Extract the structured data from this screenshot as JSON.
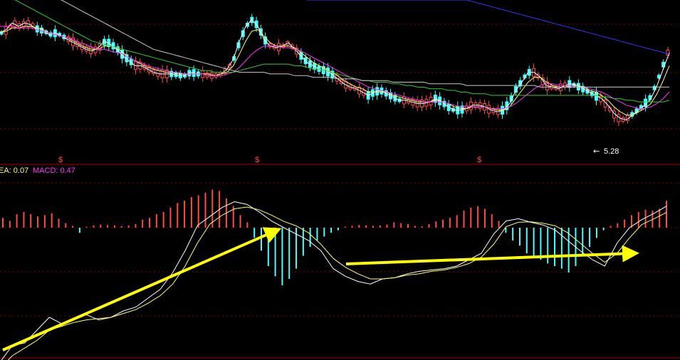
{
  "chart_data": [
    {
      "type": "candlestick",
      "panel": "price",
      "colors": {
        "up": "#ff4a4a",
        "down": "#44ffff",
        "background": "#000000",
        "grid": "#8b0000"
      },
      "low_marker": {
        "label": "5.28",
        "arrow": "←"
      },
      "event_marks": [
        "$",
        "$",
        "$"
      ],
      "series": [
        {
          "color": "#ffffff",
          "values": [
            0.8,
            0.82,
            0.86,
            0.84,
            0.86,
            0.85,
            0.82,
            0.81,
            0.79,
            0.8,
            0.78,
            0.76,
            0.74,
            0.72,
            0.7,
            0.69,
            0.71,
            0.75,
            0.73,
            0.7,
            0.66,
            0.63,
            0.6,
            0.6,
            0.58,
            0.56,
            0.55,
            0.55,
            0.55,
            0.54,
            0.54,
            0.56,
            0.55,
            0.55,
            0.54,
            0.54,
            0.55,
            0.58,
            0.64,
            0.75,
            0.84,
            0.88,
            0.84,
            0.76,
            0.72,
            0.71,
            0.72,
            0.74,
            0.7,
            0.66,
            0.62,
            0.6,
            0.58,
            0.57,
            0.55,
            0.52,
            0.49,
            0.47,
            0.46,
            0.44,
            0.42,
            0.44,
            0.45,
            0.43,
            0.41,
            0.39,
            0.39,
            0.38,
            0.37,
            0.37,
            0.38,
            0.4,
            0.38,
            0.35,
            0.33,
            0.33,
            0.34,
            0.36,
            0.36,
            0.35,
            0.33,
            0.32,
            0.33,
            0.37,
            0.45,
            0.5,
            0.56,
            0.56,
            0.53,
            0.48,
            0.47,
            0.46,
            0.48,
            0.49,
            0.48,
            0.46,
            0.44,
            0.42,
            0.4,
            0.36,
            0.31,
            0.28,
            0.27,
            0.3,
            0.33,
            0.36,
            0.4,
            0.48,
            0.58,
            0.68
          ]
        },
        {
          "color": "#ffff66",
          "values": [
            0.8,
            0.81,
            0.83,
            0.83,
            0.84,
            0.84,
            0.83,
            0.82,
            0.8,
            0.79,
            0.78,
            0.77,
            0.75,
            0.73,
            0.71,
            0.7,
            0.7,
            0.72,
            0.72,
            0.71,
            0.68,
            0.65,
            0.63,
            0.61,
            0.59,
            0.58,
            0.57,
            0.56,
            0.56,
            0.55,
            0.55,
            0.55,
            0.55,
            0.55,
            0.55,
            0.54,
            0.55,
            0.56,
            0.6,
            0.67,
            0.75,
            0.81,
            0.82,
            0.78,
            0.74,
            0.72,
            0.72,
            0.72,
            0.71,
            0.68,
            0.65,
            0.62,
            0.6,
            0.58,
            0.56,
            0.54,
            0.51,
            0.49,
            0.47,
            0.46,
            0.44,
            0.44,
            0.44,
            0.44,
            0.42,
            0.41,
            0.4,
            0.39,
            0.38,
            0.38,
            0.38,
            0.39,
            0.38,
            0.37,
            0.35,
            0.34,
            0.34,
            0.35,
            0.35,
            0.35,
            0.34,
            0.33,
            0.33,
            0.35,
            0.4,
            0.45,
            0.5,
            0.53,
            0.53,
            0.5,
            0.48,
            0.47,
            0.47,
            0.48,
            0.48,
            0.47,
            0.45,
            0.44,
            0.42,
            0.39,
            0.35,
            0.32,
            0.3,
            0.3,
            0.32,
            0.34,
            0.37,
            0.43,
            0.51,
            0.6
          ]
        },
        {
          "color": "#ff33ff",
          "values": [
            0.84,
            0.84,
            0.84,
            0.83,
            0.83,
            0.83,
            0.82,
            0.81,
            0.8,
            0.79,
            0.78,
            0.77,
            0.76,
            0.74,
            0.73,
            0.71,
            0.7,
            0.7,
            0.69,
            0.68,
            0.67,
            0.65,
            0.63,
            0.62,
            0.6,
            0.59,
            0.58,
            0.57,
            0.56,
            0.56,
            0.55,
            0.55,
            0.55,
            0.55,
            0.54,
            0.54,
            0.54,
            0.55,
            0.56,
            0.59,
            0.63,
            0.67,
            0.7,
            0.72,
            0.72,
            0.72,
            0.71,
            0.71,
            0.7,
            0.69,
            0.67,
            0.65,
            0.63,
            0.61,
            0.59,
            0.57,
            0.55,
            0.53,
            0.51,
            0.49,
            0.47,
            0.46,
            0.45,
            0.44,
            0.43,
            0.42,
            0.41,
            0.4,
            0.39,
            0.38,
            0.38,
            0.38,
            0.38,
            0.37,
            0.36,
            0.35,
            0.35,
            0.35,
            0.35,
            0.35,
            0.34,
            0.34,
            0.34,
            0.35,
            0.37,
            0.4,
            0.43,
            0.46,
            0.48,
            0.49,
            0.49,
            0.48,
            0.48,
            0.48,
            0.47,
            0.47,
            0.46,
            0.45,
            0.44,
            0.42,
            0.4,
            0.38,
            0.36,
            0.35,
            0.34,
            0.34,
            0.35,
            0.37,
            0.4,
            0.44
          ]
        },
        {
          "color": "#33cc33",
          "values": [
            1.05,
            1.03,
            1.01,
            0.99,
            0.97,
            0.95,
            0.93,
            0.91,
            0.89,
            0.87,
            0.85,
            0.83,
            0.81,
            0.79,
            0.77,
            0.75,
            0.74,
            0.73,
            0.72,
            0.71,
            0.7,
            0.69,
            0.68,
            0.67,
            0.66,
            0.65,
            0.64,
            0.63,
            0.62,
            0.61,
            0.6,
            0.59,
            0.58,
            0.57,
            0.57,
            0.56,
            0.56,
            0.56,
            0.56,
            0.57,
            0.58,
            0.59,
            0.6,
            0.61,
            0.61,
            0.61,
            0.61,
            0.61,
            0.6,
            0.6,
            0.59,
            0.58,
            0.58,
            0.57,
            0.56,
            0.55,
            0.54,
            0.53,
            0.52,
            0.51,
            0.51,
            0.5,
            0.5,
            0.5,
            0.49,
            0.49,
            0.48,
            0.48,
            0.47,
            0.47,
            0.46,
            0.46,
            0.46,
            0.45,
            0.45,
            0.44,
            0.44,
            0.43,
            0.43,
            0.43,
            0.42,
            0.42,
            0.42,
            0.42,
            0.42,
            0.42,
            0.42,
            0.42,
            0.42,
            0.42,
            0.42,
            0.42,
            0.42,
            0.42,
            0.42,
            0.42,
            0.42,
            0.42,
            0.41,
            0.41,
            0.4,
            0.4,
            0.39,
            0.39,
            0.38,
            0.38,
            0.38,
            0.38,
            0.38,
            0.39
          ]
        },
        {
          "color": "#c8c8c8",
          "values": [
            1.2,
            1.18,
            1.16,
            1.14,
            1.12,
            1.1,
            1.08,
            1.06,
            1.04,
            1.02,
            1.0,
            0.98,
            0.96,
            0.94,
            0.92,
            0.9,
            0.88,
            0.86,
            0.84,
            0.82,
            0.8,
            0.78,
            0.76,
            0.74,
            0.72,
            0.7,
            0.69,
            0.68,
            0.67,
            0.66,
            0.65,
            0.64,
            0.63,
            0.62,
            0.61,
            0.6,
            0.59,
            0.58,
            0.57,
            0.56,
            0.56,
            0.56,
            0.56,
            0.56,
            0.55,
            0.55,
            0.55,
            0.55,
            0.54,
            0.54,
            0.54,
            0.53,
            0.53,
            0.53,
            0.53,
            0.52,
            0.52,
            0.52,
            0.52,
            0.51,
            0.51,
            0.51,
            0.51,
            0.51,
            0.5,
            0.5,
            0.5,
            0.5,
            0.5,
            0.5,
            0.49,
            0.49,
            0.49,
            0.49,
            0.49,
            0.49,
            0.48,
            0.48,
            0.48,
            0.48,
            0.48,
            0.48,
            0.48,
            0.48,
            0.48,
            0.48,
            0.48,
            0.48,
            0.47,
            0.47,
            0.47,
            0.47,
            0.47,
            0.47,
            0.47,
            0.47,
            0.47,
            0.47,
            0.47,
            0.47,
            0.47,
            0.47,
            0.47,
            0.47,
            0.47,
            0.47,
            0.47,
            0.47,
            0.47,
            0.47
          ]
        },
        {
          "color": "#3333ff",
          "values": [
            1.5,
            1.49,
            1.48,
            1.47,
            1.46,
            1.45,
            1.44,
            1.43,
            1.42,
            1.41,
            1.4,
            1.39,
            1.38,
            1.37,
            1.36,
            1.35,
            1.34,
            1.33,
            1.32,
            1.31,
            1.3,
            1.29,
            1.28,
            1.27,
            1.26,
            1.25,
            1.24,
            1.23,
            1.22,
            1.21,
            1.2,
            1.19,
            1.18,
            1.17,
            1.16,
            1.15,
            1.14,
            1.13,
            1.12,
            1.11,
            1.1,
            1.09,
            1.08,
            1.07,
            1.06,
            1.05,
            1.04,
            1.03,
            1.02,
            1.01,
            1.0,
            1.0,
            1.0,
            1.0,
            1.0,
            1.0,
            1.0,
            1.0,
            1.0,
            1.0,
            1.0,
            1.0,
            1.0,
            1.0,
            1.0,
            1.0,
            1.0,
            1.0,
            1.0,
            1.0,
            1.0,
            1.0,
            1.0,
            1.0,
            1.0,
            1.0,
            1.0,
            0.99,
            0.98,
            0.97,
            0.96,
            0.95,
            0.94,
            0.93,
            0.92,
            0.91,
            0.9,
            0.89,
            0.88,
            0.87,
            0.86,
            0.85,
            0.84,
            0.83,
            0.82,
            0.81,
            0.8,
            0.79,
            0.78,
            0.77,
            0.76,
            0.75,
            0.74,
            0.73,
            0.72,
            0.71,
            0.7,
            0.69,
            0.68,
            0.67
          ]
        }
      ],
      "ylim": [
        0,
        1
      ]
    },
    {
      "type": "macd",
      "panel": "indicator",
      "header": {
        "dea_label": "EA: 0.07",
        "macd_label": "MACD: 0.47"
      },
      "header_colors": {
        "dea": "#ffff66",
        "macd": "#ff33ff"
      },
      "ylim": [
        -1,
        1
      ],
      "zero_line": true,
      "bars": {
        "positive_color": "#ff4a4a",
        "negative_color": "#44ffff",
        "values": [
          0.22,
          0.15,
          0.3,
          0.35,
          0.3,
          0.25,
          0.28,
          0.32,
          0.2,
          0.1,
          0.04,
          -0.04,
          0.02,
          0.05,
          0.07,
          0.06,
          0.05,
          0.03,
          0.05,
          0.08,
          0.18,
          0.22,
          0.3,
          0.35,
          0.45,
          0.55,
          0.6,
          0.68,
          0.72,
          0.78,
          0.85,
          0.82,
          0.65,
          0.48,
          0.28,
          0.12,
          -0.08,
          -0.18,
          -0.3,
          -0.38,
          -0.45,
          -0.4,
          -0.32,
          -0.22,
          -0.15,
          -0.1,
          -0.07,
          -0.04,
          -0.02,
          0.02,
          0.04,
          0.06,
          0.05,
          0.04,
          0.05,
          0.07,
          0.12,
          0.1,
          0.08,
          0.04,
          0.03,
          0.08,
          0.14,
          0.18,
          0.22,
          0.28,
          0.38,
          0.45,
          0.48,
          0.42,
          0.3,
          0.15,
          -0.04,
          -0.1,
          -0.14,
          -0.2,
          -0.22,
          -0.25,
          -0.28,
          -0.3,
          -0.32,
          -0.35,
          -0.3,
          -0.22,
          -0.15,
          -0.08,
          -0.02,
          0.04,
          0.1,
          0.18,
          0.28,
          0.35,
          0.4,
          0.38,
          0.42,
          0.6
        ]
      },
      "series": [
        {
          "name": "DIF",
          "color": "#ffffff",
          "values": [
            -1.05,
            -0.92,
            -0.9,
            -0.8,
            -0.7,
            -0.75,
            -0.72,
            -0.68,
            -0.72,
            -0.7,
            -0.65,
            -0.62,
            -0.55,
            -0.48,
            -0.35,
            -0.18,
            0.05,
            0.25,
            0.45,
            0.58,
            0.52,
            0.35,
            0.15,
            0.0,
            -0.05,
            -0.1,
            -0.18,
            -0.32,
            -0.38,
            -0.42,
            -0.44,
            -0.4,
            -0.39,
            -0.36,
            -0.34,
            -0.33,
            -0.32,
            -0.3,
            -0.25,
            -0.2,
            -0.05,
            0.15,
            0.2,
            0.12,
            0.06,
            -0.02,
            -0.1,
            -0.18,
            -0.25,
            -0.3,
            -0.12,
            0.0,
            0.18,
            0.32,
            0.48
          ]
        },
        {
          "name": "DEA",
          "color": "#ffff66",
          "values": [
            -1.1,
            -1.0,
            -0.94,
            -0.88,
            -0.8,
            -0.77,
            -0.74,
            -0.72,
            -0.71,
            -0.7,
            -0.67,
            -0.64,
            -0.59,
            -0.53,
            -0.44,
            -0.3,
            -0.12,
            0.08,
            0.28,
            0.42,
            0.46,
            0.4,
            0.28,
            0.14,
            0.04,
            -0.04,
            -0.13,
            -0.24,
            -0.31,
            -0.36,
            -0.4,
            -0.4,
            -0.39,
            -0.37,
            -0.36,
            -0.34,
            -0.33,
            -0.31,
            -0.28,
            -0.23,
            -0.13,
            0.02,
            0.12,
            0.13,
            0.1,
            0.04,
            -0.04,
            -0.12,
            -0.2,
            -0.27,
            -0.2,
            -0.08,
            0.07,
            0.2,
            0.34
          ]
        }
      ]
    }
  ]
}
